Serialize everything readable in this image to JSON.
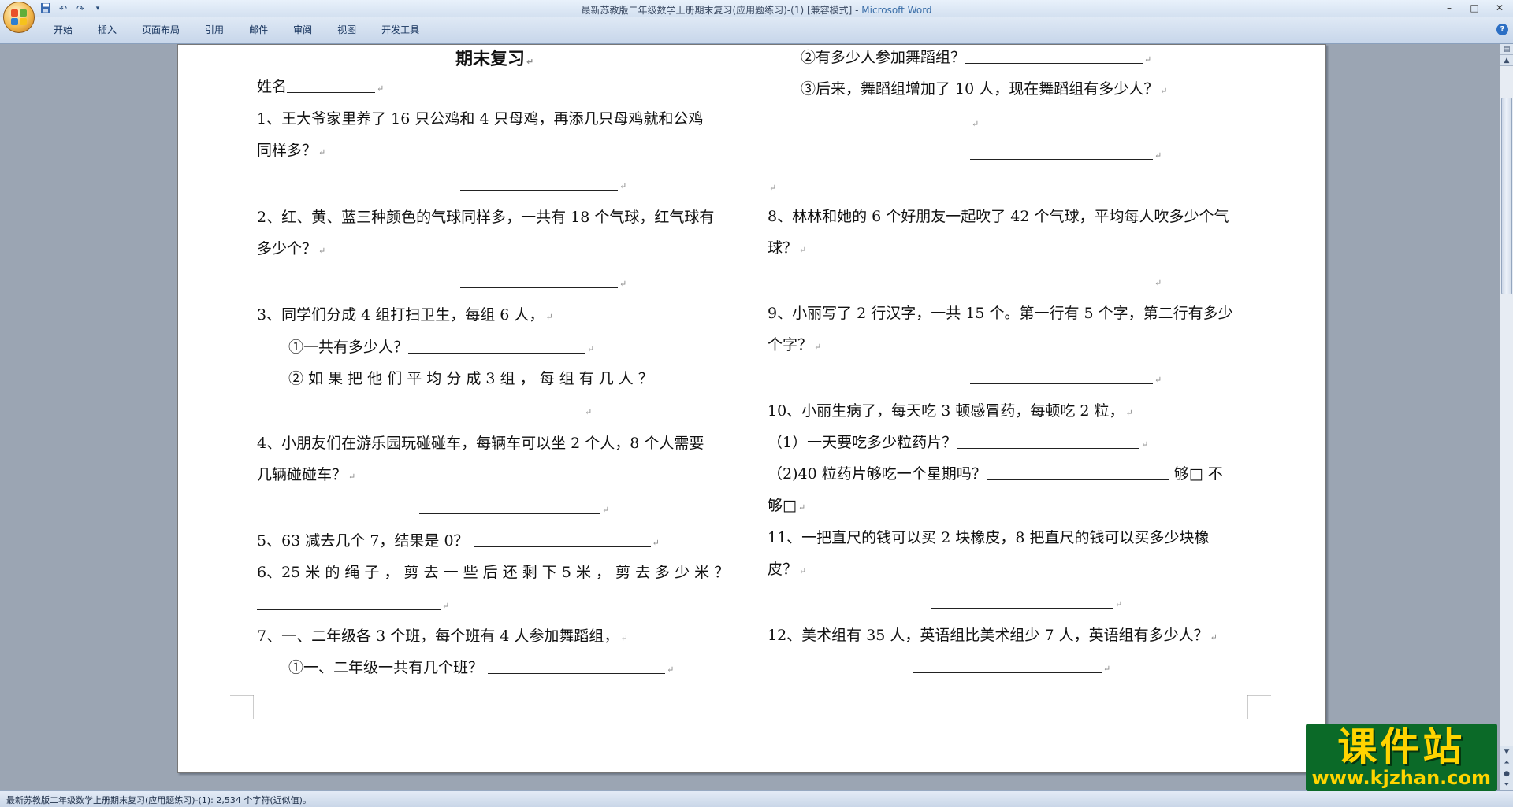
{
  "window": {
    "title": "最新苏教版二年级数学上册期末复习(应用题练习)-(1) [兼容模式] - ",
    "app_name": "Microsoft Word",
    "minimize": "–",
    "maximize": "□",
    "close": "✕"
  },
  "quick_access": {
    "save_icon": "save-icon",
    "undo_icon": "undo-icon",
    "redo_icon": "redo-icon",
    "customize_icon": "dropdown-icon"
  },
  "ribbon": {
    "tabs": [
      "开始",
      "插入",
      "页面布局",
      "引用",
      "邮件",
      "审阅",
      "视图",
      "开发工具"
    ],
    "help": "?"
  },
  "document": {
    "title": "期末复习",
    "name_label": "姓名",
    "left": [
      "1、王大爷家里养了 16 只公鸡和 4 只母鸡，再添几只母鸡就和公鸡",
      "同样多？",
      "2、红、黄、蓝三种颜色的气球同样多，一共有 18 个气球，红气球有",
      "多少个？",
      "3、同学们分成 4 组打扫卫生，每组 6 人，",
      "①一共有多少人？",
      "② 如 果 把 他 们 平 均 分 成  3  组 ， 每 组 有 几 人 ？",
      "4、小朋友们在游乐园玩碰碰车，每辆车可以坐 2 个人，8 个人需要",
      "几辆碰碰车？",
      "5、63 减去几个 7，结果是 0？",
      "6、25  米 的 绳 子 ， 剪 去 一 些 后 还 剩 下  5  米 ， 剪 去 多 少 米 ？",
      "7、一、二年级各 3 个班，每个班有 4 人参加舞蹈组，",
      "①一、二年级一共有几个班？"
    ],
    "right": [
      "②有多少人参加舞蹈组？",
      "③后来，舞蹈组增加了 10 人，现在舞蹈组有多少人？",
      "8、林林和她的 6 个好朋友一起吹了 42 个气球，平均每人吹多少个气",
      "球？",
      "9、小丽写了 2 行汉字，一共 15 个。第一行有 5 个字，第二行有多少",
      "个字？",
      "10、小丽生病了，每天吃 3 顿感冒药，每顿吃 2 粒，",
      "（1）一天要吃多少粒药片？",
      "（2)40 粒药片够吃一个星期吗？",
      "够□  不",
      "够□",
      "11、一把直尺的钱可以买  2  块橡皮，8  把直尺的钱可以买多少块橡",
      "皮？",
      "12、美术组有 35 人，英语组比美术组少 7 人，英语组有多少人？"
    ],
    "paragraph_mark": "↵"
  },
  "status_bar": {
    "text": "最新苏教版二年级数学上册期末复习(应用题练习)-(1): 2,534 个字符(近似值)。"
  },
  "watermark": {
    "title": "课件站",
    "url": "www.kjzhan.com"
  },
  "colors": {
    "workspace": "#9ba5b3",
    "ribbon": "#c7d6ea",
    "watermark_bg": "#0b6a28",
    "watermark_text": "#ffd400"
  }
}
